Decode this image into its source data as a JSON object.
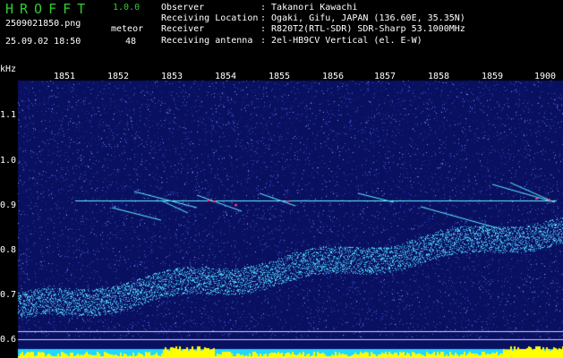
{
  "header": {
    "app_title": "HROFFT",
    "version": "1.0.0",
    "filename": "2509021850.png",
    "datetime": "25.09.02 18:50",
    "meteor_label": "meteor",
    "meteor_count": "48",
    "info": [
      {
        "key": "Observer",
        "value": ": Takanori Kawachi"
      },
      {
        "key": "Receiving Location",
        "value": ": Ogaki, Gifu, JAPAN (136.60E, 35.35N)"
      },
      {
        "key": "Receiver",
        "value": ": R820T2(RTL-SDR) SDR-Sharp 53.1000MHz"
      },
      {
        "key": "Receiving antenna",
        "value": ": 2el-HB9CV Vertical (el. E-W)"
      }
    ]
  },
  "spectrogram": {
    "y_unit": "kHz",
    "x_ticks": [
      "1851",
      "1852",
      "1853",
      "1854",
      "1855",
      "1856",
      "1857",
      "1858",
      "1859",
      "1900"
    ],
    "y_ticks": [
      "1.1",
      "1.0",
      "0.9",
      "0.8",
      "0.7",
      "0.6"
    ],
    "colors": {
      "background": "#0a1060",
      "noise": "#3f5fd8",
      "signal": "#60f0ff",
      "hot": "#ff3060",
      "level_bar": "#ffff00",
      "level_base": "#20d8ff"
    }
  }
}
